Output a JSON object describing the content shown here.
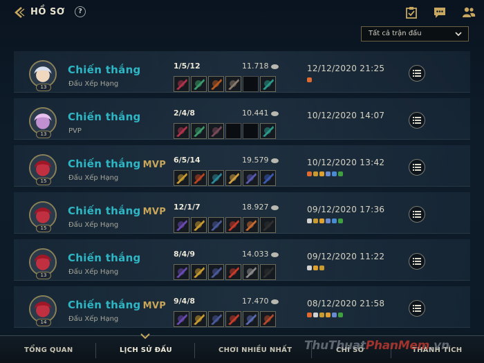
{
  "header": {
    "title": "HỒ SƠ",
    "help": "?"
  },
  "filter": {
    "selected": "Tất cả trận đấu"
  },
  "matches": [
    {
      "result": "Chiến thắng",
      "mvp": "",
      "mode": "Đấu Xếp Hạng",
      "level": "13",
      "kda": "1/5/12",
      "gold": "11.718",
      "date": "12/12/2020 21:25"
    },
    {
      "result": "Chiến thắng",
      "mvp": "",
      "mode": "PVP",
      "level": "13",
      "kda": "2/4/8",
      "gold": "10.441",
      "date": "10/12/2020 14:07"
    },
    {
      "result": "Chiến thắng",
      "mvp": "MVP",
      "mode": "Đấu Xếp Hạng",
      "level": "15",
      "kda": "6/5/14",
      "gold": "19.579",
      "date": "10/12/2020 13:42"
    },
    {
      "result": "Chiến thắng",
      "mvp": "MVP",
      "mode": "Đấu Xếp Hạng",
      "level": "15",
      "kda": "12/1/7",
      "gold": "18.927",
      "date": "09/12/2020 17:36"
    },
    {
      "result": "Chiến thắng",
      "mvp": "",
      "mode": "Đấu Xếp Hạng",
      "level": "13",
      "kda": "8/4/9",
      "gold": "14.033",
      "date": "09/12/2020 11:22"
    },
    {
      "result": "Chiến thắng",
      "mvp": "MVP",
      "mode": "Đấu Xếp Hạng",
      "level": "14",
      "kda": "9/4/8",
      "gold": "17.470",
      "date": "08/12/2020 21:58"
    }
  ],
  "nav": {
    "tabs": [
      "TỔNG QUAN",
      "LỊCH SỬ ĐẤU",
      "CHƠI NHIỀU NHẤT",
      "CHỈ SỐ",
      "THÀNH TÍCH"
    ],
    "active": "LỊCH SỬ ĐẤU"
  },
  "watermark": {
    "part1": "ThuThuat",
    "part2": "PhanMem",
    "part3": ".vn"
  },
  "colors": {
    "win": "#2fb6c4",
    "mvp": "#c7a65a",
    "accent": "#c8a860"
  }
}
